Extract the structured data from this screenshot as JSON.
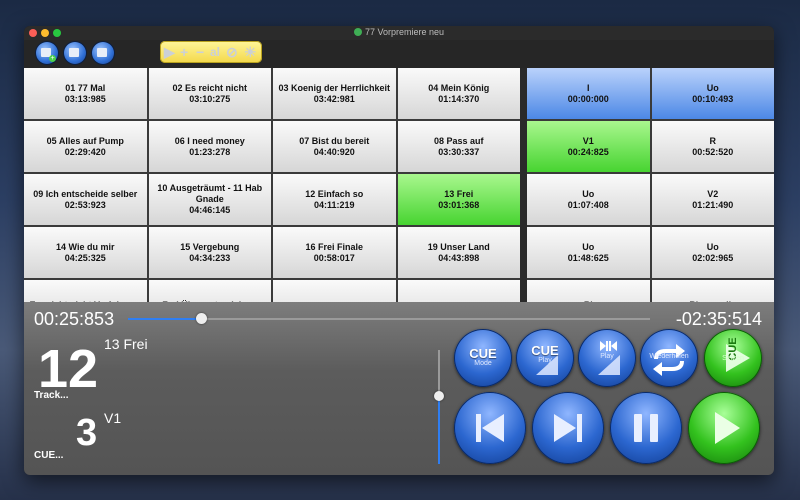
{
  "window": {
    "title": "77 Vorpremiere neu"
  },
  "toolbar": {
    "yellow_glyphs": [
      "▶",
      "+",
      "−",
      "al",
      "⊘",
      "☀"
    ]
  },
  "tracks": [
    {
      "title": "01 77 Mal",
      "time": "03:13:985"
    },
    {
      "title": "02 Es reicht nicht",
      "time": "03:10:275"
    },
    {
      "title": "03 Koenig der Herrlichkeit",
      "time": "03:42:981"
    },
    {
      "title": "04 Mein König",
      "time": "01:14:370"
    },
    {
      "title": "05 Alles auf Pump",
      "time": "02:29:420"
    },
    {
      "title": "06 I need money",
      "time": "01:23:278"
    },
    {
      "title": "07 Bist du bereit",
      "time": "04:40:920"
    },
    {
      "title": "08 Pass auf",
      "time": "03:30:337"
    },
    {
      "title": "09 Ich entscheide selber",
      "time": "02:53:923"
    },
    {
      "title": "10 Ausgeträumt - 11 Hab Gnade",
      "time": "04:46:145"
    },
    {
      "title": "12 Einfach so",
      "time": "04:11:219"
    },
    {
      "title": "13 Frei",
      "time": "03:01:368",
      "active": true
    },
    {
      "title": "14 Wie du mir",
      "time": "04:25:325"
    },
    {
      "title": "15 Vergebung",
      "time": "04:34:233"
    },
    {
      "title": "16 Frei Finale",
      "time": "00:58:017"
    },
    {
      "title": "19 Unser Land",
      "time": "04:43:898"
    },
    {
      "title": "Es reicht nicht Verfolgung",
      "time": ""
    },
    {
      "title": "Frei Übungstrack lang",
      "time": ""
    },
    {
      "title": "",
      "time": ""
    },
    {
      "title": "",
      "time": ""
    }
  ],
  "cues": [
    {
      "title": "I",
      "time": "00:00:000",
      "state": "blue"
    },
    {
      "title": "Uo",
      "time": "00:10:493",
      "state": "blue"
    },
    {
      "title": "V1",
      "time": "00:24:825",
      "state": "green"
    },
    {
      "title": "R",
      "time": "00:52:520",
      "state": ""
    },
    {
      "title": "Uo",
      "time": "01:07:408",
      "state": ""
    },
    {
      "title": "V2",
      "time": "01:21:490",
      "state": ""
    },
    {
      "title": "Uo",
      "time": "01:48:625",
      "state": ""
    },
    {
      "title": "Uo",
      "time": "02:02:965",
      "state": ""
    },
    {
      "title": "R'",
      "time": "",
      "state": ""
    },
    {
      "title": "R' acapella",
      "time": "",
      "state": ""
    }
  ],
  "player": {
    "elapsed": "00:25:853",
    "remaining": "-02:35:514",
    "progress_fraction": 0.14,
    "volume_fraction": 0.6,
    "track_number": "12",
    "track_name": "13 Frei",
    "track_label": "Track...",
    "cue_number": "3",
    "cue_name": "V1",
    "cue_label": "CUE..."
  },
  "buttons": {
    "cue_mode": {
      "big": "CUE",
      "small": "Mode"
    },
    "cue_play": {
      "big": "CUE",
      "small": "Play"
    },
    "skip_play": {
      "small": "Play"
    },
    "repeat": {
      "small": "Wiederholen"
    },
    "cue_set": {
      "big": "CUE",
      "small": "Setzen"
    }
  },
  "colors": {
    "active_green": "#47d431",
    "active_blue": "#4c88e6",
    "progress_blue": "#2f7ef2"
  }
}
